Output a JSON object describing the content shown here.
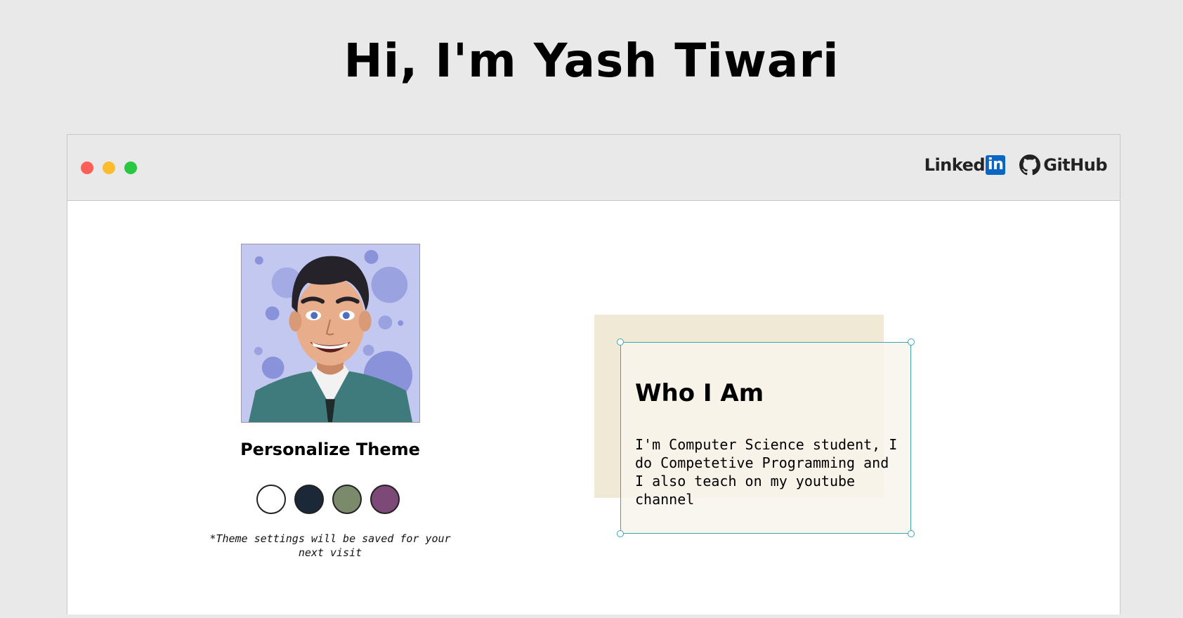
{
  "header": {
    "title": "Hi, I'm Yash Tiwari"
  },
  "window": {
    "controls": [
      "close",
      "minimize",
      "maximize"
    ],
    "links": {
      "linkedin_text": "Linked",
      "linkedin_badge": "in",
      "github_label": "GitHub"
    }
  },
  "profile": {
    "avatar_icon": "cartoon-avatar"
  },
  "theme": {
    "title": "Personalize Theme",
    "swatches": [
      {
        "name": "light",
        "color": "#ffffff"
      },
      {
        "name": "dark-navy",
        "color": "#1b2838"
      },
      {
        "name": "sage-green",
        "color": "#7a8a6a"
      },
      {
        "name": "plum",
        "color": "#7d4a78"
      }
    ],
    "note": "*Theme settings will be saved for your next visit"
  },
  "about": {
    "heading": "Who I Am",
    "text": "I'm Computer Science student, I do Competetive Programming and I also teach on my youtube channel"
  },
  "colors": {
    "accent": "#3ea6b3",
    "card_bg": "#f0e9d6",
    "window_bar": "#e9e9e9"
  }
}
